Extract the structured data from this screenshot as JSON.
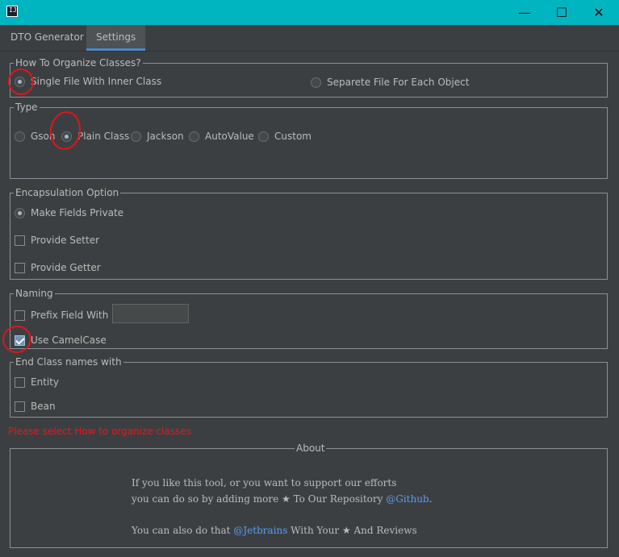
{
  "window": {
    "icon_text": "IJ",
    "minimize": "—",
    "maximize": "☐",
    "close": "✕"
  },
  "tabs": [
    {
      "label": "DTO Generator"
    },
    {
      "label": "Settings"
    }
  ],
  "organize": {
    "legend": "How To Organize Classes?",
    "options": [
      {
        "label": "Single File With Inner Class",
        "selected": true
      },
      {
        "label": "Separete File For Each Object",
        "selected": false
      }
    ]
  },
  "type": {
    "legend": "Type",
    "options": [
      {
        "label": "Gson",
        "selected": false
      },
      {
        "label": "Plain Class",
        "selected": true
      },
      {
        "label": "Jackson",
        "selected": false
      },
      {
        "label": "AutoValue",
        "selected": false
      },
      {
        "label": "Custom",
        "selected": false
      }
    ]
  },
  "encapsulation": {
    "legend": "Encapsulation Option",
    "options": [
      {
        "label": "Make Fields Private",
        "checked": true
      },
      {
        "label": "Provide Setter",
        "checked": false
      },
      {
        "label": "Provide Getter",
        "checked": false
      }
    ]
  },
  "naming": {
    "legend": "Naming",
    "prefix_label": "Prefix Field With",
    "prefix_value": "",
    "camelcase_label": "Use CamelCase",
    "camelcase_checked": true
  },
  "end_class": {
    "legend": "End Class names with",
    "options": [
      {
        "label": "Entity",
        "checked": false
      },
      {
        "label": "Bean",
        "checked": false
      }
    ]
  },
  "error_message": "Please select How to organize classes",
  "about": {
    "legend": "About",
    "line1": "If you like this tool, or you want to support our efforts",
    "line2_pre": "you can do so by adding more ★ To Our Repository ",
    "line2_link": "@Github",
    "line2_post": ".",
    "line3_pre": "You can also do that ",
    "line3_link": "@Jetbrains",
    "line3_post": " With Your ★ And Reviews"
  },
  "colors": {
    "titlebar": "#00b4c0",
    "background": "#3c3f41",
    "accent": "#4a88c7",
    "error": "#e8161b",
    "link": "#589df6",
    "annotation": "#e0141c"
  }
}
